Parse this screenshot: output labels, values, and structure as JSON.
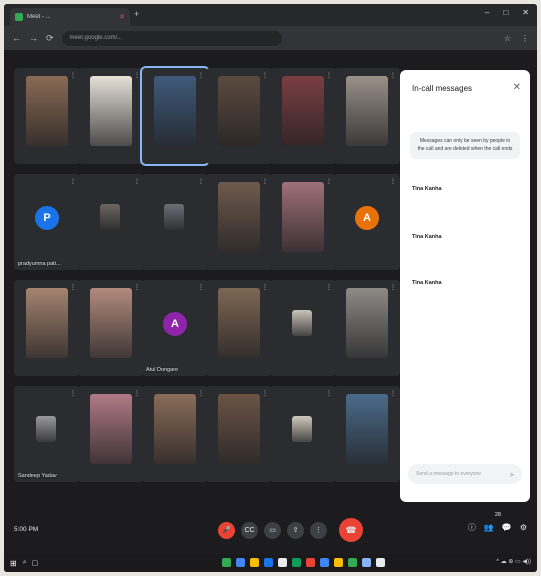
{
  "browser": {
    "tab_title": "Meet - ...",
    "new_tab_glyph": "+",
    "url": "meet.google.com/...",
    "window_controls": [
      "–",
      "□",
      "✕"
    ],
    "nav_glyphs": [
      "←",
      "→",
      "⟳"
    ],
    "right_icons": [
      "☆",
      "⋮"
    ]
  },
  "tiles": [
    {
      "name": "",
      "kind": "photo",
      "color": "#8a6a55"
    },
    {
      "name": "",
      "kind": "photo",
      "color": "#e6e0d8"
    },
    {
      "name": "",
      "kind": "photo",
      "color": "#3f5a7a",
      "speaking": true
    },
    {
      "name": "",
      "kind": "photo",
      "color": "#5b4a3e"
    },
    {
      "name": "",
      "kind": "photo",
      "color": "#7a3e42"
    },
    {
      "name": "",
      "kind": "photo",
      "color": "#9a9188"
    },
    {
      "name": "pradyumna pati...",
      "kind": "avatar",
      "letter": "P",
      "color": "#1a73e8"
    },
    {
      "name": "",
      "kind": "small",
      "color": "#6b6660"
    },
    {
      "name": "",
      "kind": "small",
      "color": "#6a6f75"
    },
    {
      "name": "",
      "kind": "photo",
      "color": "#6e5a4c"
    },
    {
      "name": "",
      "kind": "photo",
      "color": "#a07078"
    },
    {
      "name": "",
      "kind": "avatar",
      "letter": "A",
      "color": "#e8710a"
    },
    {
      "name": "",
      "kind": "photo",
      "color": "#a58470"
    },
    {
      "name": "",
      "kind": "photo",
      "color": "#b28b7e"
    },
    {
      "name": "Atul Dongare",
      "kind": "avatar",
      "letter": "A",
      "color": "#8e24aa"
    },
    {
      "name": "",
      "kind": "photo",
      "color": "#7d6753"
    },
    {
      "name": "",
      "kind": "small",
      "color": "#c9c2b7"
    },
    {
      "name": "",
      "kind": "photo",
      "color": "#8d8a86"
    },
    {
      "name": "Sandeep Yadav",
      "kind": "small",
      "color": "#9a9a9a"
    },
    {
      "name": "",
      "kind": "photo",
      "color": "#b07a86"
    },
    {
      "name": "",
      "kind": "photo",
      "color": "#8a6c58"
    },
    {
      "name": "",
      "kind": "photo",
      "color": "#6a5446"
    },
    {
      "name": "",
      "kind": "small",
      "color": "#d0c9bd"
    },
    {
      "name": "",
      "kind": "photo",
      "color": "#4a6b8a"
    }
  ],
  "chat": {
    "title": "In-call messages",
    "close_glyph": "✕",
    "notice": "Messages can only be seen by people in the call and are deleted when the call ends",
    "messages": [
      {
        "sender": "Tina Kanha",
        "time": "",
        "text": ""
      },
      {
        "sender": "Tina Kanha",
        "time": "",
        "text": ""
      },
      {
        "sender": "Tina Kanha",
        "time": "",
        "text": ""
      },
      {
        "sender": "",
        "time": "",
        "text": ""
      }
    ],
    "input_placeholder": "Send a message to everyone",
    "send_glyph": "➤"
  },
  "meetbar": {
    "clock": "5:00 PM",
    "meeting_code": "",
    "people_count": "28",
    "controls": [
      "🎤",
      "CC",
      "▭",
      "⇪",
      "⋮"
    ],
    "end_glyph": "☎",
    "right_icons": [
      "ⓘ",
      "👥",
      "💬",
      "⚙"
    ]
  },
  "taskbar": {
    "start_glyph": "⊞",
    "left_icons": [
      "⌕",
      "▢"
    ],
    "app_colors": [
      "#34a853",
      "#4285f4",
      "#fbbc05",
      "#1a73e8",
      "#e8eaed",
      "#0f9d58",
      "#ea4335",
      "#4285f4",
      "#fbbc05",
      "#34a853",
      "#8ab4f8",
      "#e8eaed"
    ],
    "tray_text": "^ ☁ ⊕ ▭ ◀))"
  }
}
